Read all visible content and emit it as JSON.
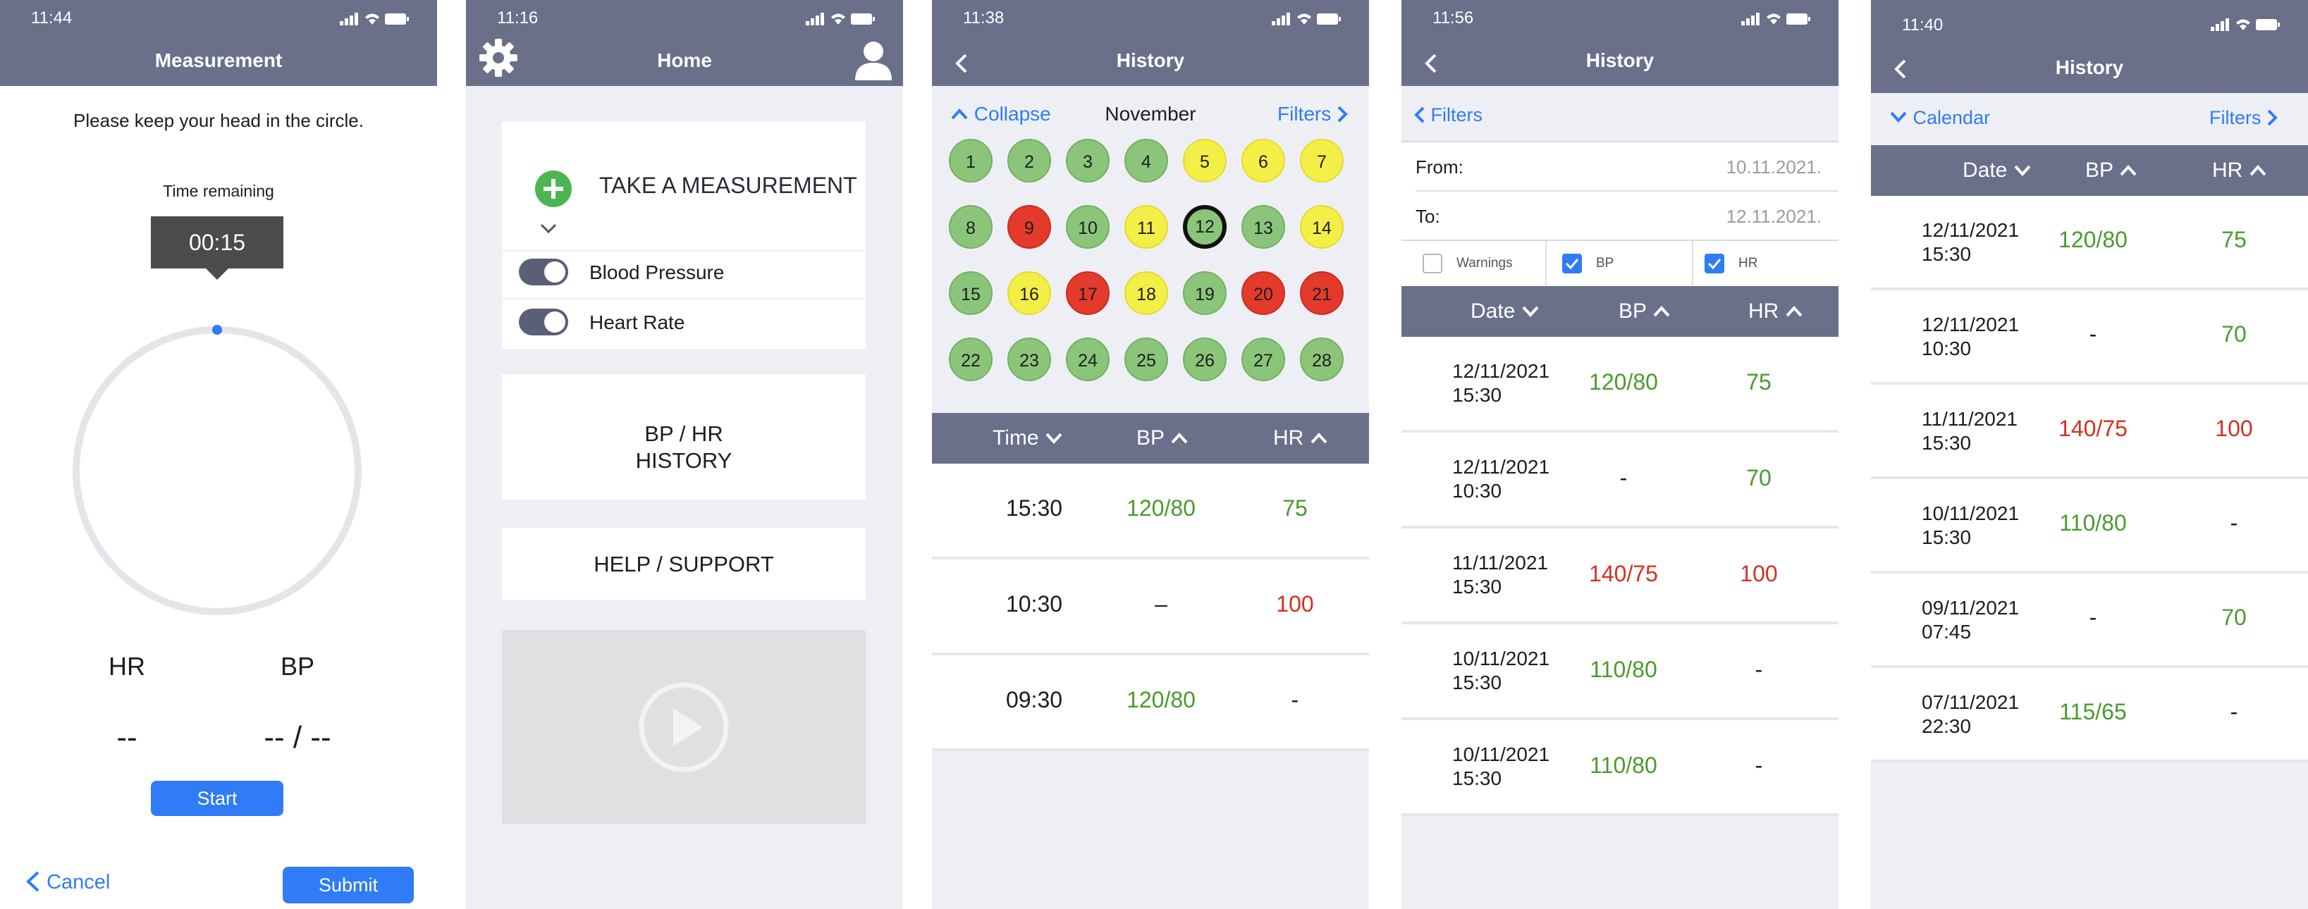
{
  "screen1": {
    "time": "11:44",
    "title": "Measurement",
    "instruction": "Please keep your head in the circle.",
    "time_remaining_label": "Time remaining",
    "timer": "00:15",
    "hr_label": "HR",
    "bp_label": "BP",
    "hr_value": "--",
    "bp_value": "-- / --",
    "start_label": "Start",
    "cancel_label": "Cancel",
    "submit_label": "Submit"
  },
  "screen2": {
    "time": "11:16",
    "title": "Home",
    "take_measurement": "TAKE A MEASUREMENT",
    "blood_pressure": "Blood Pressure",
    "heart_rate": "Heart Rate",
    "history_line1": "BP / HR",
    "history_line2": "HISTORY",
    "help": "HELP / SUPPORT"
  },
  "screen3": {
    "time": "11:38",
    "title": "History",
    "collapse": "Collapse",
    "month": "November",
    "filters": "Filters",
    "days": [
      {
        "d": "1",
        "s": "green"
      },
      {
        "d": "2",
        "s": "green"
      },
      {
        "d": "3",
        "s": "green"
      },
      {
        "d": "4",
        "s": "green"
      },
      {
        "d": "5",
        "s": "yellow"
      },
      {
        "d": "6",
        "s": "yellow"
      },
      {
        "d": "7",
        "s": "yellow"
      },
      {
        "d": "8",
        "s": "green"
      },
      {
        "d": "9",
        "s": "red"
      },
      {
        "d": "10",
        "s": "green"
      },
      {
        "d": "11",
        "s": "yellow"
      },
      {
        "d": "12",
        "s": "green"
      },
      {
        "d": "13",
        "s": "green"
      },
      {
        "d": "14",
        "s": "yellow"
      },
      {
        "d": "15",
        "s": "green"
      },
      {
        "d": "16",
        "s": "yellow"
      },
      {
        "d": "17",
        "s": "red"
      },
      {
        "d": "18",
        "s": "yellow"
      },
      {
        "d": "19",
        "s": "green"
      },
      {
        "d": "20",
        "s": "red"
      },
      {
        "d": "21",
        "s": "red"
      },
      {
        "d": "22",
        "s": "green"
      },
      {
        "d": "23",
        "s": "green"
      },
      {
        "d": "24",
        "s": "green"
      },
      {
        "d": "25",
        "s": "green"
      },
      {
        "d": "26",
        "s": "green"
      },
      {
        "d": "27",
        "s": "green"
      },
      {
        "d": "28",
        "s": "green"
      }
    ],
    "selected_day": "12",
    "headers": {
      "time": "Time",
      "bp": "BP",
      "hr": "HR"
    },
    "rows": [
      {
        "time": "15:30",
        "bp": "120/80",
        "hr": "75"
      },
      {
        "time": "10:30",
        "bp": "–",
        "hr": "100"
      },
      {
        "time": "09:30",
        "bp": "120/80",
        "hr": "-"
      }
    ]
  },
  "screen4": {
    "time": "11:56",
    "title": "History",
    "filters": "Filters",
    "from_label": "From:",
    "from_value": "10.11.2021.",
    "to_label": "To:",
    "to_value": "12.11.2021.",
    "warnings": "Warnings",
    "bp": "BP",
    "hr": "HR",
    "headers": {
      "date": "Date",
      "bp": "BP",
      "hr": "HR"
    },
    "rows": [
      {
        "date": "12/11/2021",
        "time": "15:30",
        "bp": "120/80",
        "hr": "75"
      },
      {
        "date": "12/11/2021",
        "time": "10:30",
        "bp": "-",
        "hr": "70"
      },
      {
        "date": "11/11/2021",
        "time": "15:30",
        "bp": "140/75",
        "hr": "100"
      },
      {
        "date": "10/11/2021",
        "time": "15:30",
        "bp": "110/80",
        "hr": "-"
      },
      {
        "date": "10/11/2021",
        "time": "15:30",
        "bp": "110/80",
        "hr": "-"
      }
    ]
  },
  "screen5": {
    "time": "11:40",
    "title": "History",
    "calendar": "Calendar",
    "filters": "Filters",
    "headers": {
      "date": "Date",
      "bp": "BP",
      "hr": "HR"
    },
    "rows": [
      {
        "date": "12/11/2021",
        "time": "15:30",
        "bp": "120/80",
        "hr": "75"
      },
      {
        "date": "12/11/2021",
        "time": "10:30",
        "bp": "-",
        "hr": "70"
      },
      {
        "date": "11/11/2021",
        "time": "15:30",
        "bp": "140/75",
        "hr": "100"
      },
      {
        "date": "10/11/2021",
        "time": "15:30",
        "bp": "110/80",
        "hr": "-"
      },
      {
        "date": "09/11/2021",
        "time": "07:45",
        "bp": "-",
        "hr": "70"
      },
      {
        "date": "07/11/2021",
        "time": "22:30",
        "bp": "115/65",
        "hr": "-"
      }
    ]
  }
}
